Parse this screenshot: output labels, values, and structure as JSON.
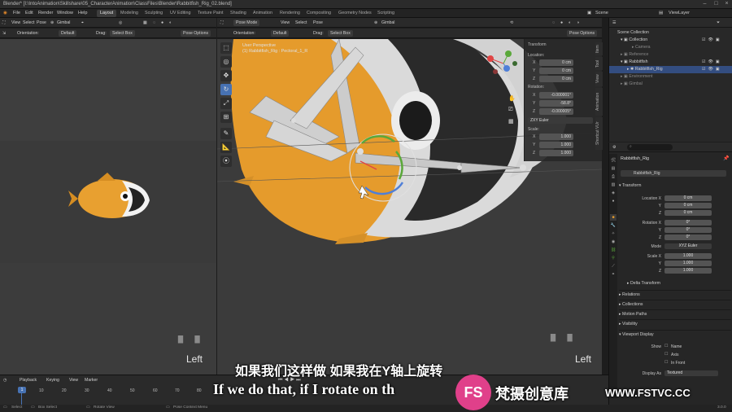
{
  "titlebar": {
    "title": "Blender* [I:\\IntoAnimation\\Skillshare\\05_CharacterAnimation\\ClassFiles\\Blender\\Rabbitfish_Rig_02.blend]"
  },
  "menu": [
    "File",
    "Edit",
    "Render",
    "Window",
    "Help"
  ],
  "workspaces": [
    "Layout",
    "Modeling",
    "Sculpting",
    "UV Editing",
    "Texture Paint",
    "Shading",
    "Animation",
    "Rendering",
    "Compositing",
    "Geometry Nodes",
    "Scripting"
  ],
  "scene": {
    "label": "Scene",
    "viewlayer": "ViewLayer"
  },
  "left_header": {
    "mode": "Pose",
    "transform": "Gimbal"
  },
  "left_header2": {
    "orientation_label": "Orientation:",
    "orientation": "Default",
    "drag_label": "Drag:",
    "drag": "Select Box",
    "pose_options": "Pose Options"
  },
  "left_menus": [
    "View",
    "Select",
    "Pose"
  ],
  "main_header": {
    "mode": "Pose Mode",
    "menus": [
      "View",
      "Select",
      "Pose"
    ],
    "transform": "Gimbal",
    "pose_options": "Pose Options"
  },
  "main_header2": {
    "orientation_label": "Orientation:",
    "orientation": "Default",
    "drag_label": "Drag:",
    "drag": "Select Box"
  },
  "viewport": {
    "perspective": "User Perspective",
    "active": "(1) Rabbitfish_Rig : Pectoral_1_R"
  },
  "view_labels": {
    "left": "Left",
    "right": "Left"
  },
  "npanel": {
    "section": "Transform",
    "location_label": "Location:",
    "location": [
      {
        "axis": "X",
        "value": "0 cm"
      },
      {
        "axis": "Y",
        "value": "0 cm"
      },
      {
        "axis": "Z",
        "value": "0 cm"
      }
    ],
    "rotation_label": "Rotation:",
    "rotation": [
      {
        "axis": "X",
        "value": "-0.000001°"
      },
      {
        "axis": "Y",
        "value": "-58.8°"
      },
      {
        "axis": "Z",
        "value": "-0.000005°"
      }
    ],
    "rotation_mode": "ZXY Euler",
    "scale_label": "Scale:",
    "scale": [
      {
        "axis": "X",
        "value": "1.000"
      },
      {
        "axis": "Y",
        "value": "1.000"
      },
      {
        "axis": "Z",
        "value": "1.000"
      }
    ],
    "tabs": [
      "Item",
      "Tool",
      "View",
      "Animation",
      "Shortcut VUr"
    ]
  },
  "outliner": {
    "items": [
      "Scene Collection",
      "Collection",
      "Camera",
      "Reference",
      "Rabbitfish",
      "Rabbitfish_Rig",
      "Environment",
      "Gimbal"
    ]
  },
  "properties": {
    "search": "",
    "object_name": "Rabbitfish_Rig",
    "object_field": "Rabbitfish_Rig",
    "transform_label": "Transform",
    "location_x_label": "Location X",
    "location_x": "0 cm",
    "location_y_label": "Y",
    "location_y": "0 cm",
    "location_z_label": "Z",
    "location_z": "0 cm",
    "rotation_x_label": "Rotation X",
    "rotation_x": "0°",
    "rotation_y_label": "Y",
    "rotation_y": "0°",
    "rotation_z_label": "Z",
    "rotation_z": "0°",
    "mode_label": "Mode",
    "mode": "XYZ Euler",
    "scale_x_label": "Scale X",
    "scale_x": "1.000",
    "scale_y_label": "Y",
    "scale_y": "1.000",
    "scale_z_label": "Z",
    "scale_z": "1.000",
    "sections": [
      "Delta Transform",
      "Relations",
      "Collections",
      "Motion Paths",
      "Visibility",
      "Viewport Display"
    ],
    "show_label": "Show",
    "show_options": [
      "Name",
      "Axis",
      "In Front"
    ],
    "display_as_label": "Display As",
    "display_as": "Textured"
  },
  "timeline": {
    "menus": [
      "Playback",
      "Keying",
      "View",
      "Marker"
    ],
    "current_frame": "1",
    "ticks": [
      "10",
      "20",
      "30",
      "40",
      "50",
      "60",
      "70",
      "80"
    ]
  },
  "status": {
    "items": [
      "Select",
      "Box Select",
      "Rotate View",
      "Pose Context Menu"
    ],
    "version": "3.0.0"
  },
  "subtitles": {
    "chinese": "如果我们这样做 如果我在Y轴上旋转",
    "english": "If we do that, if I rotate on th"
  },
  "watermark": {
    "logo": "FS",
    "brand_cn": "梵摄创意库",
    "url": "WWW.FSTVC.CC"
  },
  "colors": {
    "accent": "#4772b3",
    "fish_orange": "#e8a030",
    "watermark_pink": "#e0408a"
  }
}
